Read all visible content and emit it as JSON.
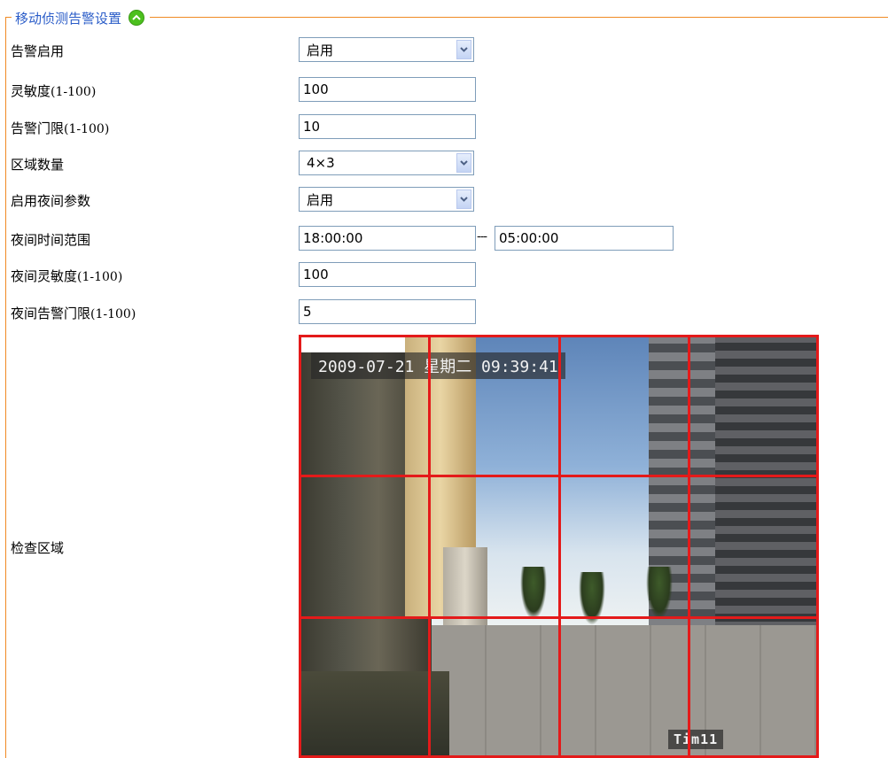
{
  "section": {
    "legend": "移动侦测告警设置",
    "collapse_icon": "chevron-up-icon",
    "accent_color": "#f08a24",
    "legend_color": "#2a5cc8"
  },
  "fields": {
    "alarm_enable": {
      "label": "告警启用",
      "value": "启用"
    },
    "sensitivity": {
      "label": "灵敏度",
      "range": "(1-100)",
      "value": "100"
    },
    "alarm_threshold": {
      "label": "告警门限",
      "range": "(1-100)",
      "value": "10"
    },
    "region_count": {
      "label": "区域数量",
      "value": "4×3"
    },
    "night_params": {
      "label": "启用夜间参数",
      "value": "启用"
    },
    "night_time_range": {
      "label": "夜间时间范围",
      "start": "18:00:00",
      "separator": "---",
      "end": "05:00:00"
    },
    "night_sensitivity": {
      "label": "夜间灵敏度",
      "range": "(1-100)",
      "value": "100"
    },
    "night_threshold": {
      "label": "夜间告警门限",
      "range": "(1-100)",
      "value": "5"
    },
    "detection_area": {
      "label": "检查区域"
    }
  },
  "video": {
    "timestamp": "2009-07-21  星期二 09:39:41",
    "camera_name": "Tim11",
    "grid": {
      "columns": 4,
      "rows": 3,
      "color": "#e41a1a"
    }
  }
}
